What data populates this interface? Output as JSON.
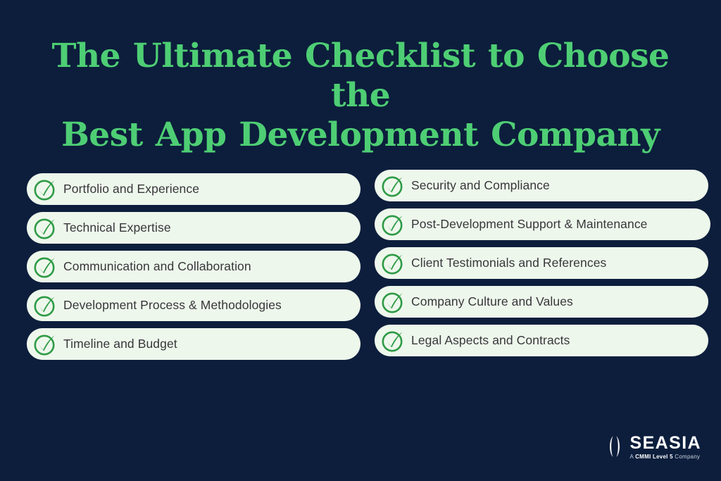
{
  "theme": {
    "background_color": "#0c1e3c",
    "title_color": "#4ece74",
    "pill_background": "#eef7ec",
    "pill_text_color": "#37373a",
    "check_color": "#2e9b46",
    "logo_text_color": "#ffffff"
  },
  "header": {
    "title_line_1": "The Ultimate Checklist to Choose the",
    "title_line_2": "Best App Development Company"
  },
  "checklist": {
    "left_column": [
      {
        "label": "Portfolio and Experience",
        "icon": "check-circle-icon"
      },
      {
        "label": "Technical Expertise",
        "icon": "check-circle-icon"
      },
      {
        "label": "Communication and Collaboration",
        "icon": "check-circle-icon"
      },
      {
        "label": "Development Process & Methodologies",
        "icon": "check-circle-icon"
      },
      {
        "label": "Timeline and Budget",
        "icon": "check-circle-icon"
      }
    ],
    "right_column": [
      {
        "label": "Security and Compliance",
        "icon": "check-circle-icon"
      },
      {
        "label": "Post-Development Support & Maintenance",
        "icon": "check-circle-icon"
      },
      {
        "label": "Client Testimonials and References",
        "icon": "check-circle-icon"
      },
      {
        "label": "Company Culture and Values",
        "icon": "check-circle-icon"
      },
      {
        "label": "Legal Aspects and Contracts",
        "icon": "check-circle-icon"
      }
    ]
  },
  "logo": {
    "mark": "seasia-arcs-icon",
    "name": "SEASIA",
    "tagline_prefix": "A ",
    "tagline_bold": "CMMI Level 5",
    "tagline_suffix": " Company"
  }
}
